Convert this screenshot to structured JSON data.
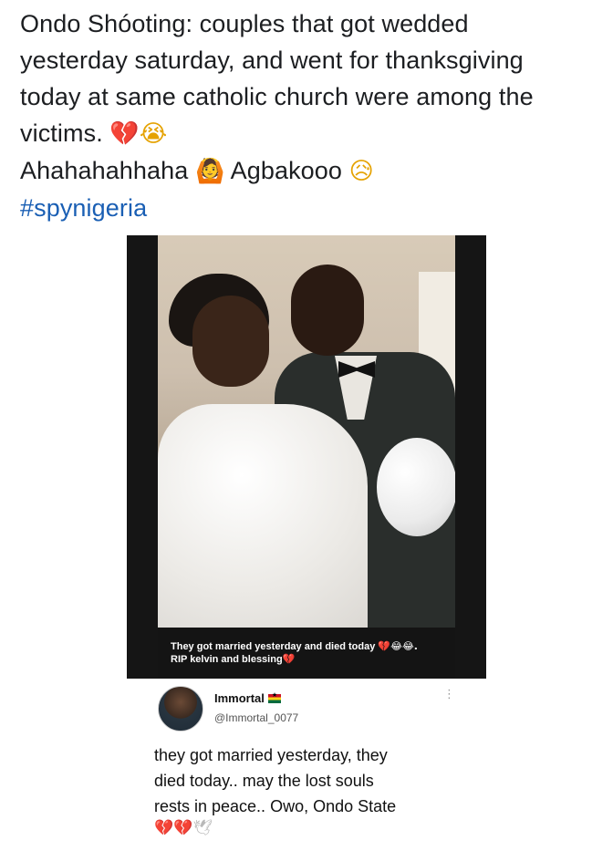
{
  "post": {
    "line1": "Ondo Shóoting: couples that got wedded",
    "line2": "yesterday saturday, and went for thanksgiving",
    "line3": "today at same catholic church were among the",
    "line4": "victims.",
    "line5_a": "Ahahahahhaha",
    "line5_b": "Agbakooo",
    "hashtag": "#spynigeria",
    "emojis": {
      "broken_heart": "💔",
      "crying_face": "😭",
      "person_gesturing": "🙆",
      "sad_face": "😥"
    }
  },
  "photo": {
    "caption_line1": "They got married yesterday and died today",
    "caption_line2": "RIP kelvin and blessing",
    "caption_emojis_1": "💔😂😂.",
    "caption_emojis_2": "💔"
  },
  "tweet": {
    "name": "Immortal",
    "handle": "@Immortal_0077",
    "body_line1": "they got married yesterday, they",
    "body_line2": "died today.. may the lost souls",
    "body_line3": "rests in peace.. Owo, Ondo State",
    "emojis": "💔💔",
    "dove": "🕊",
    "menu": "⋮"
  },
  "colors": {
    "text": "#1c1e21",
    "hashtag": "#1a5fb4",
    "photo_background": "#151515",
    "heart": "#d7263d"
  }
}
